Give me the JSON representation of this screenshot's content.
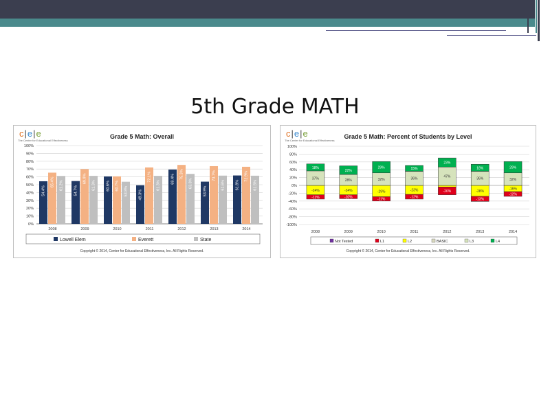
{
  "slide": {
    "title": "5th Grade MATH"
  },
  "logo": {
    "letters": [
      "c",
      "e",
      "e"
    ],
    "subtitle": "The Center for Educational Effectiveness"
  },
  "copyright": "Copyright © 2014, Center for Educational Effectiveness, Inc. All Rights Reserved.",
  "colors": {
    "header_dark": "#3b3e4f",
    "header_teal": "#4a8a8c",
    "lowell": "#1f3864",
    "everett": "#f4b183",
    "state": "#bfbfbf",
    "not_tested": "#7030a0",
    "l1": "#e0001b",
    "l2": "#ffff00",
    "basic": "#d9d9c0",
    "l3": "#d6e3bc",
    "l4": "#00b050"
  },
  "chart_data": [
    {
      "type": "bar",
      "title": "Grade 5 Math: Overall",
      "categories": [
        "2008",
        "2009",
        "2010",
        "2011",
        "2012",
        "2013",
        "2014"
      ],
      "series": [
        {
          "name": "Lowell Elem",
          "values": [
            54.4,
            54.7,
            60.6,
            49.3,
            69.4,
            53.9,
            61.8
          ]
        },
        {
          "name": "Everett",
          "values": [
            65.4,
            69.9,
            60.7,
            72.1,
            75.3,
            73.7,
            72.9
          ]
        },
        {
          "name": "State",
          "values": [
            61.2,
            61.3,
            53.8,
            61.3,
            63.8,
            61.6,
            61.5
          ]
        }
      ],
      "value_labels": [
        [
          "54.4%",
          "54.7%",
          "60.6%",
          "49.3%",
          "69.4%",
          "53.9%",
          "61.8%"
        ],
        [
          "65.4%",
          "69.9%",
          "60.7%",
          "72.1%",
          "75.3%",
          "73.7%",
          "72.9%"
        ],
        [
          "61.2%",
          "61.3%",
          "53.8%",
          "61.3%",
          "63.8%",
          "61.6%",
          "61.5%"
        ]
      ],
      "yticks": [
        "100%",
        "90%",
        "80%",
        "70%",
        "60%",
        "50%",
        "40%",
        "30%",
        "20%",
        "10%",
        "0%"
      ],
      "ylim": [
        0,
        100
      ],
      "grid": true,
      "legend": "bottom"
    },
    {
      "type": "bar",
      "stacked": true,
      "title": "Grade 5 Math: Percent of Students by Level",
      "categories": [
        "2008",
        "2009",
        "2010",
        "2011",
        "2012",
        "2013",
        "2014"
      ],
      "series": [
        {
          "name": "Not Tested",
          "values": [
            0,
            0,
            0,
            0,
            0,
            0,
            0
          ]
        },
        {
          "name": "L1",
          "values": [
            -11,
            -10,
            -11,
            -12,
            -20,
            -13,
            -12
          ]
        },
        {
          "name": "L2",
          "values": [
            -24,
            -24,
            -29,
            -23,
            -4,
            -28,
            -16
          ]
        },
        {
          "name": "BASIC",
          "values": [
            0,
            0,
            0,
            0,
            0,
            0,
            0
          ]
        },
        {
          "name": "L3",
          "values": [
            37,
            28,
            32,
            36,
            47,
            36,
            32
          ]
        },
        {
          "name": "L4",
          "values": [
            18,
            22,
            29,
            15,
            23,
            18,
            29
          ]
        }
      ],
      "value_labels": {
        "L1": [
          "-11%",
          "-10%",
          "-11%",
          "-12%",
          "-20%",
          "-13%",
          "-12%"
        ],
        "L2": [
          "-24%",
          "-24%",
          "-29%",
          "-23%",
          "",
          "-28%",
          "-16%"
        ],
        "L3": [
          "37%",
          "28%",
          "32%",
          "36%",
          "47%",
          "36%",
          "32%"
        ],
        "L4": [
          "18%",
          "22%",
          "29%",
          "15%",
          "23%",
          "18%",
          "29%"
        ]
      },
      "yticks": [
        "100%",
        "80%",
        "60%",
        "40%",
        "20%",
        "0%",
        "-20%",
        "-40%",
        "-60%",
        "-80%",
        "-100%"
      ],
      "ylim": [
        -100,
        100
      ],
      "grid": true,
      "legend": "bottom"
    }
  ]
}
